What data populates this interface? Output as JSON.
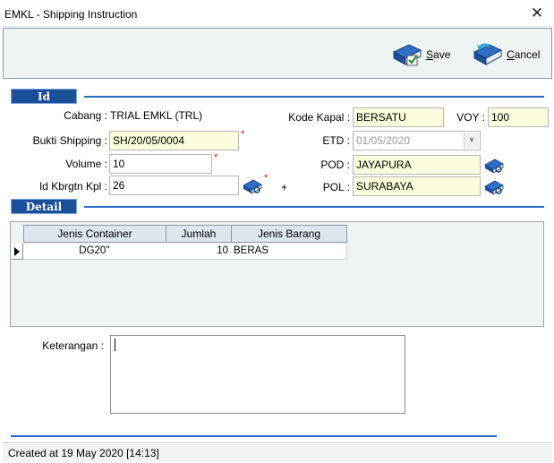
{
  "window": {
    "title": "EMKL - Shipping Instruction",
    "close_glyph": "✕"
  },
  "toolbar": {
    "save": {
      "icon": "book-check-icon",
      "prefix": "",
      "hotkey": "S",
      "rest": "ave"
    },
    "cancel": {
      "icon": "book-undo-icon",
      "hotkey": "C",
      "rest": "ancel"
    }
  },
  "sections": {
    "id": "Id",
    "detail": "Detail"
  },
  "form": {
    "cabang": {
      "label": "Cabang :",
      "value": "TRIAL EMKL (TRL)"
    },
    "bukti_shipping": {
      "label": "Bukti Shipping :",
      "value": "SH/20/05/0004",
      "required": "*"
    },
    "volume": {
      "label": "Volume  :",
      "value": "10",
      "required": "*"
    },
    "id_kbrgtn_kpl": {
      "label": "Id Kbrgtn Kpl :",
      "value": "26",
      "required": "*",
      "plus": "+"
    },
    "kode_kapal": {
      "label": "Kode Kapal :",
      "value": "BERSATU"
    },
    "voy": {
      "label": "VOY :",
      "value": "100"
    },
    "etd": {
      "label": "ETD :",
      "value": "01/05/2020"
    },
    "pod": {
      "label": "POD :",
      "value": "JAYAPURA"
    },
    "pol": {
      "label": "POL :",
      "value": "SURABAYA"
    },
    "keterangan": {
      "label": "Keterangan :",
      "value": ""
    }
  },
  "grid": {
    "columns": [
      "Jenis Container",
      "Jumlah",
      "Jenis Barang"
    ],
    "rows": [
      {
        "jenis_container": "DG20''",
        "jumlah": "10",
        "jenis_barang": "BERAS"
      }
    ]
  },
  "status": {
    "text": "Created at 19 May 2020 [14:13]"
  },
  "colors": {
    "section_header": "#1a4f9a",
    "section_line": "#2a6cc4",
    "field_bg": "#fdfcdc",
    "required": "#e01010"
  }
}
